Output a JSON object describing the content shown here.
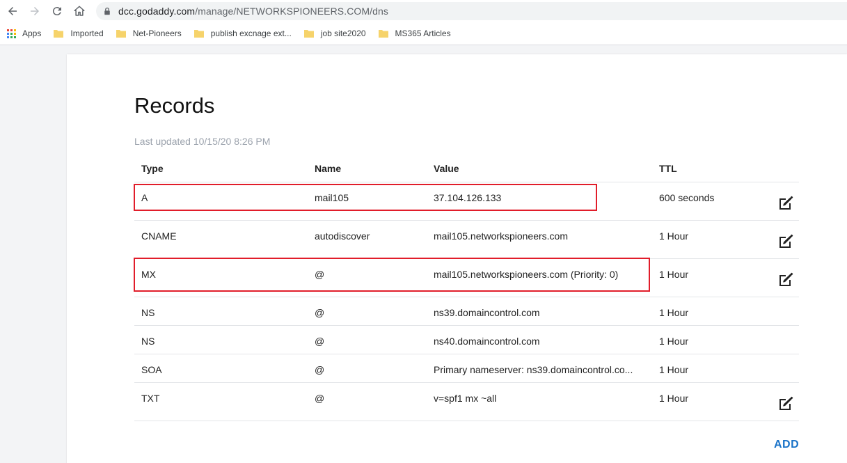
{
  "browser": {
    "url_host": "dcc.godaddy.com",
    "url_path": "/manage/NETWORKSPIONEERS.COM/dns",
    "bookmarks": [
      {
        "label": "Apps"
      },
      {
        "label": "Imported"
      },
      {
        "label": "Net-Pioneers"
      },
      {
        "label": "publish excnage ext..."
      },
      {
        "label": "job site2020"
      },
      {
        "label": "MS365 Articles"
      }
    ]
  },
  "page": {
    "title": "Records",
    "last_updated": "Last updated 10/15/20 8:26 PM",
    "add_label": "ADD"
  },
  "table": {
    "headers": {
      "type": "Type",
      "name": "Name",
      "value": "Value",
      "ttl": "TTL"
    },
    "rows": [
      {
        "type": "A",
        "name": "mail105",
        "value": "37.104.126.133",
        "ttl": "600 seconds",
        "editable": true,
        "highlighted": true
      },
      {
        "type": "CNAME",
        "name": "autodiscover",
        "value": "mail105.networkspioneers.com",
        "ttl": "1 Hour",
        "editable": true,
        "highlighted": false
      },
      {
        "type": "MX",
        "name": "@",
        "value": "mail105.networkspioneers.com (Priority: 0)",
        "ttl": "1 Hour",
        "editable": true,
        "highlighted": true
      },
      {
        "type": "NS",
        "name": "@",
        "value": "ns39.domaincontrol.com",
        "ttl": "1 Hour",
        "editable": false,
        "highlighted": false
      },
      {
        "type": "NS",
        "name": "@",
        "value": "ns40.domaincontrol.com",
        "ttl": "1 Hour",
        "editable": false,
        "highlighted": false
      },
      {
        "type": "SOA",
        "name": "@",
        "value": "Primary nameserver: ns39.domaincontrol.co...",
        "ttl": "1 Hour",
        "editable": false,
        "highlighted": false
      },
      {
        "type": "TXT",
        "name": "@",
        "value": "v=spf1 mx ~all",
        "ttl": "1 Hour",
        "editable": true,
        "highlighted": false
      }
    ]
  },
  "colors": {
    "accent": "#1a73c8",
    "highlight": "#e11d2a"
  }
}
